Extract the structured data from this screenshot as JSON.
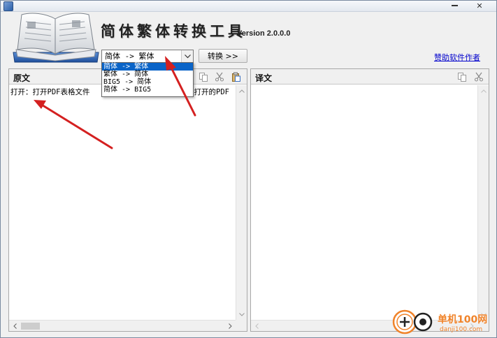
{
  "window": {
    "title_icon": "app-book-icon",
    "minimize_icon": "minimize-icon",
    "close_icon": "close-icon",
    "close_glyph": "✕"
  },
  "header": {
    "title": "简体繁体转换工具",
    "version": "Version 2.0.0.0",
    "logo_icon": "open-book-logo"
  },
  "conversion": {
    "selected": "简体 -> 繁体",
    "options": [
      "简体 -> 繁体",
      "繁体 -> 简体",
      "BIG5 -> 简体",
      "简体 -> BIG5"
    ],
    "selected_index": 0,
    "convert_label": "转换 >>",
    "sponsor_link": "赞助软件作者"
  },
  "left_panel": {
    "title": "原文",
    "toolbar_icons": [
      "copy-icon",
      "cut-icon",
      "paste-icon"
    ],
    "text_visible_start": "打开：打开PDF表格文件",
    "text_visible_end": "前打开的PDF"
  },
  "right_panel": {
    "title": "译文",
    "toolbar_icons": [
      "copy-icon",
      "cut-icon"
    ],
    "text": ""
  },
  "watermark": {
    "brand_top": "单机100网",
    "brand_bottom": "danji100.com"
  },
  "colors": {
    "selection": "#0a64c8",
    "link": "#0000cc",
    "arrow": "#d42020",
    "watermark": "#f0832a"
  }
}
